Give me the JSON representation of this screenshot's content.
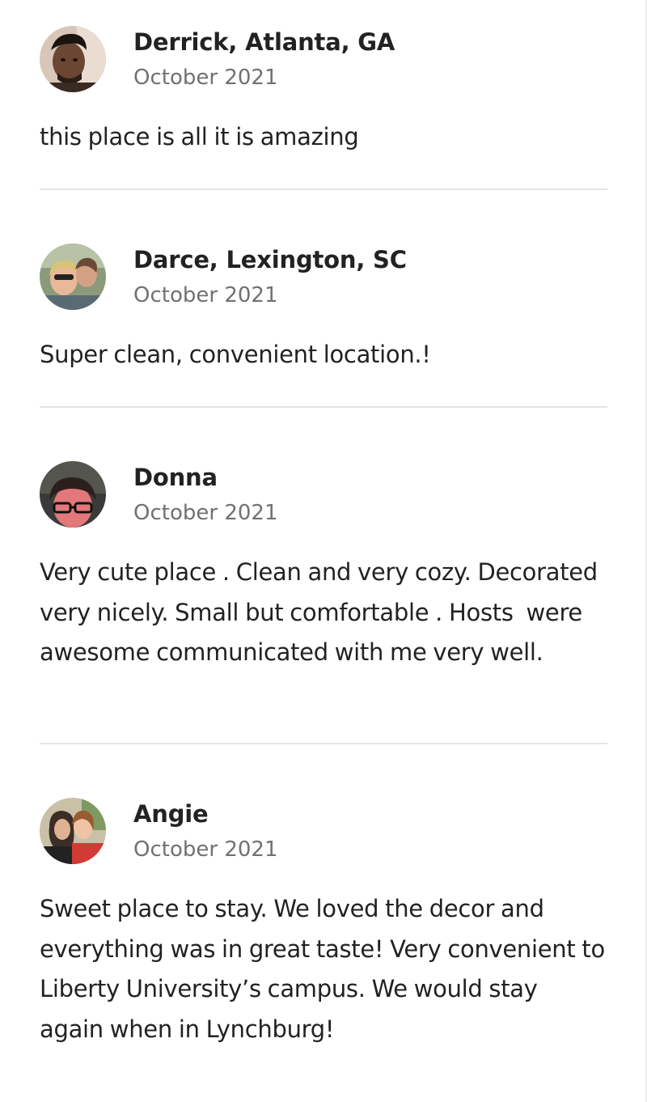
{
  "reviews": [
    {
      "name": "Derrick, Atlanta, GA",
      "date": "October 2021",
      "text": "this place is all it is amazing",
      "avatar_icon": "profile-photo-man"
    },
    {
      "name": "Darce, Lexington, SC",
      "date": "October 2021",
      "text": "Super clean, convenient location.!",
      "avatar_icon": "profile-photo-two-women"
    },
    {
      "name": "Donna",
      "date": "October 2021",
      "text": "Very cute place . Clean and very cozy. Decorated very nicely. Small but comfortable . Hosts  were awesome communicated with me very well.",
      "avatar_icon": "profile-photo-woman-glasses"
    },
    {
      "name": "Angie",
      "date": "October 2021",
      "text": "Sweet place to stay. We loved the decor and everything was in great taste! Very convenient to Liberty University’s campus. We would stay again when in Lynchburg!",
      "avatar_icon": "profile-photo-two-women"
    }
  ],
  "colors": {
    "text_primary": "#222222",
    "text_secondary": "#717171",
    "divider": "#e4e4e4",
    "background": "#ffffff"
  }
}
